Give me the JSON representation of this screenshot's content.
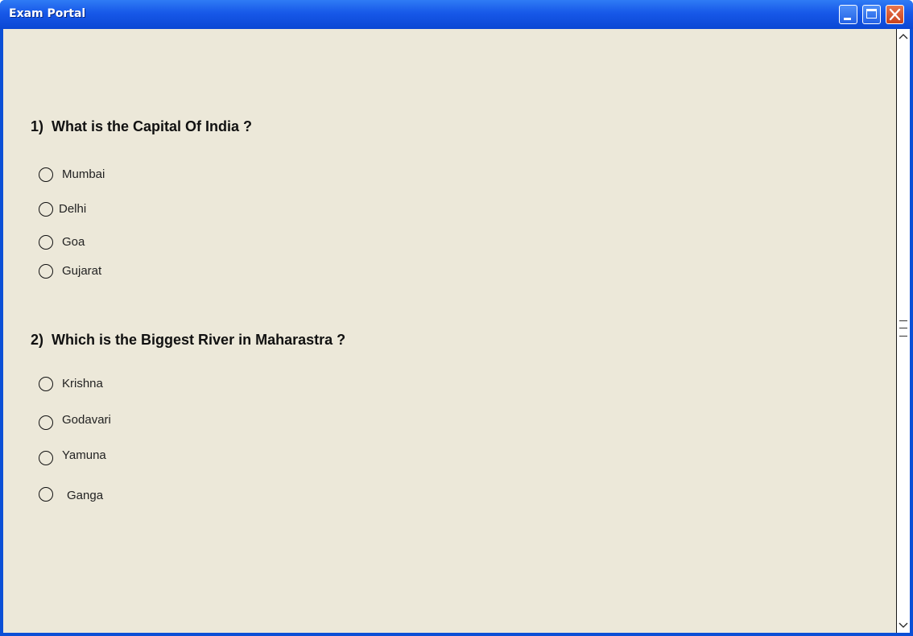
{
  "window": {
    "title": "Exam Portal",
    "controls": {
      "minimize": "minimize-icon",
      "maximize": "maximize-icon",
      "close": "close-icon"
    }
  },
  "questions": [
    {
      "number": "1)",
      "text": "What is the Capital Of India ?",
      "options": [
        "Mumbai",
        "Delhi",
        "Goa",
        "Gujarat"
      ]
    },
    {
      "number": "2)",
      "text": "Which is the Biggest River in Maharastra ?",
      "options": [
        "Krishna",
        "Godavari",
        "Yamuna",
        "Ganga"
      ]
    }
  ],
  "colors": {
    "titlebar": "#1758e8",
    "client_background": "#ece8d9",
    "close_button": "#d9582f"
  }
}
